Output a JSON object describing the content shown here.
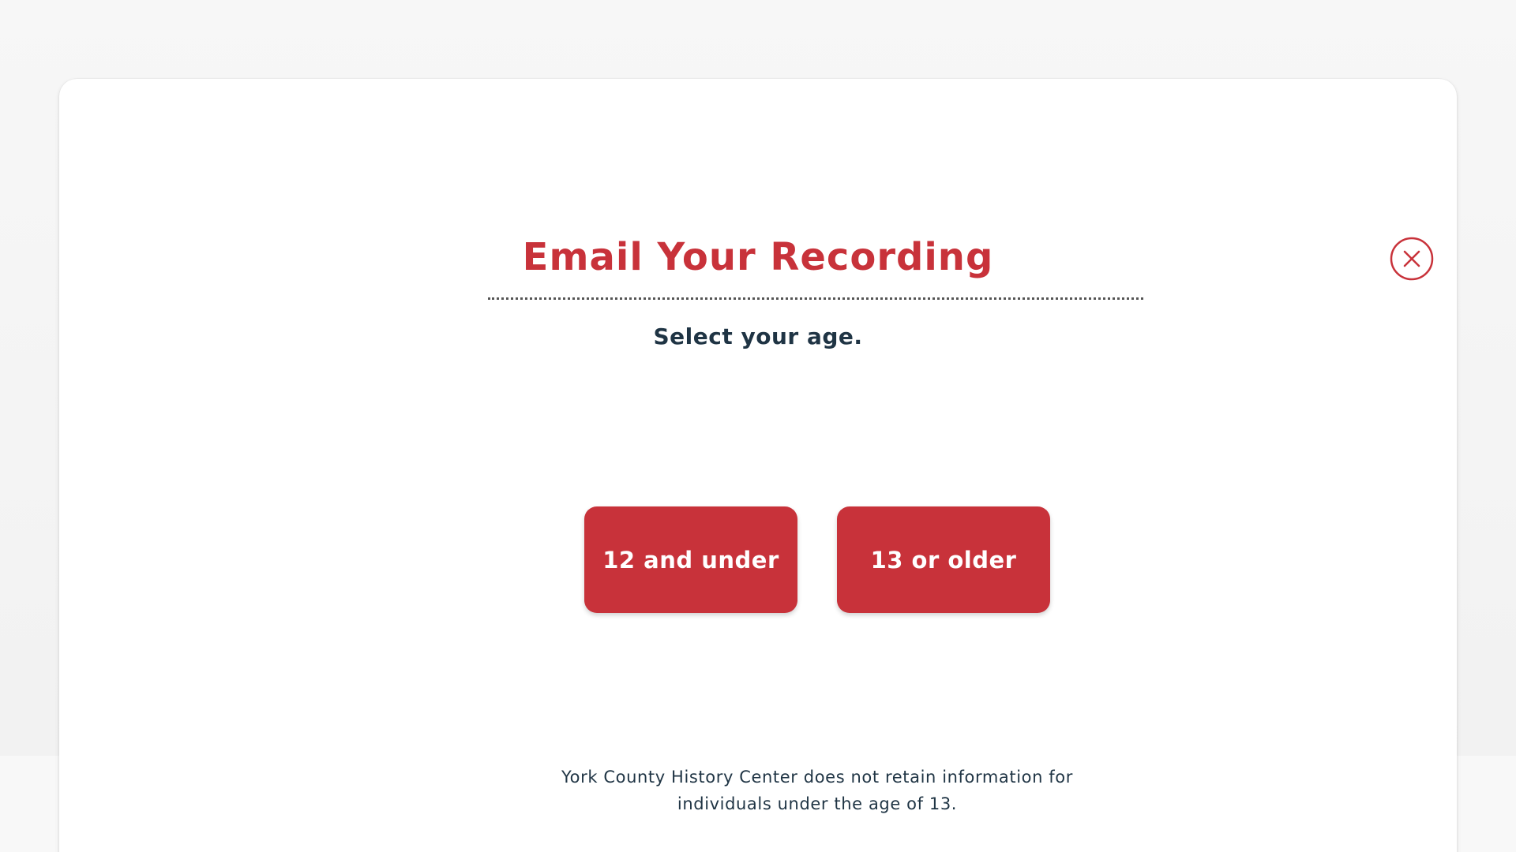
{
  "theme": {
    "accent": "#c8323a",
    "text_dark": "#1f3444",
    "button_text": "#ffffff",
    "modal_bg": "#ffffff"
  },
  "modal": {
    "title": "Email Your Recording",
    "subtitle": "Select your age.",
    "close_icon": "close-circle-icon",
    "options": [
      {
        "label": "12 and under"
      },
      {
        "label": "13 or older"
      }
    ],
    "disclaimer": {
      "line1": "York County History Center does not retain information for",
      "line2": "individuals under the age of 13."
    }
  }
}
